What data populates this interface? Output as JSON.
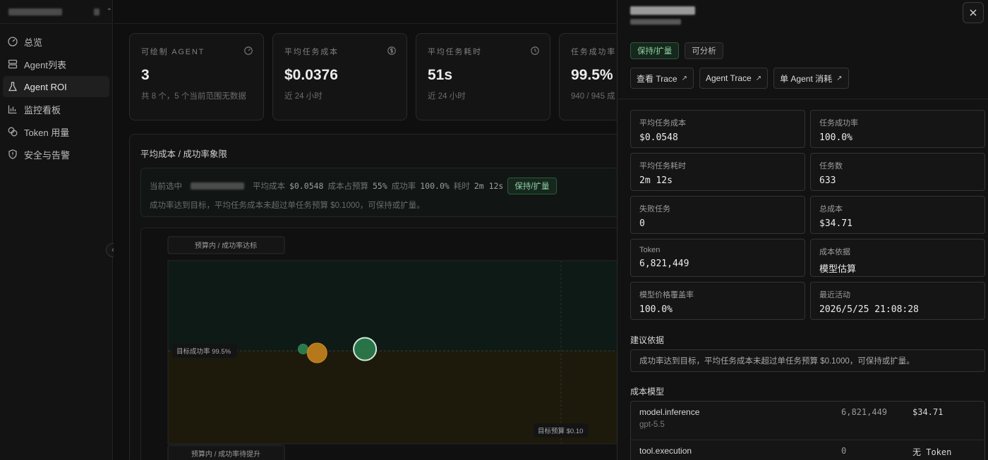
{
  "sidebar": {
    "workspace_switch_icon": "chevron-updown-icon",
    "collapse_icon": "chevron-left-icon",
    "items": [
      {
        "label": "总览",
        "icon": "gauge-icon",
        "active": false
      },
      {
        "label": "Agent列表",
        "icon": "server-icon",
        "active": false
      },
      {
        "label": "Agent ROI",
        "icon": "flask-icon",
        "active": true
      },
      {
        "label": "监控看板",
        "icon": "bar-chart-icon",
        "active": false
      },
      {
        "label": "Token 用量",
        "icon": "coins-icon",
        "active": false
      },
      {
        "label": "安全与告警",
        "icon": "shield-alert-icon",
        "active": false
      }
    ]
  },
  "kpis": [
    {
      "label": "可绘制 AGENT",
      "value": "3",
      "sub": "共 8 个，5 个当前范围无数据",
      "icon": "gauge-icon"
    },
    {
      "label": "平均任务成本",
      "value": "$0.0376",
      "sub": "近 24 小时",
      "icon": "dollar-circle-icon"
    },
    {
      "label": "平均任务耗时",
      "value": "51s",
      "sub": "近 24 小时",
      "icon": "clock-icon"
    },
    {
      "label": "任务成功率",
      "value": "99.5%",
      "sub": "940 / 945 成",
      "icon": ""
    }
  ],
  "quadrant_panel": {
    "title": "平均成本 / 成功率象限",
    "selected": {
      "prefix": "当前选中",
      "cost_label": "平均成本",
      "cost_value": "$0.0548",
      "budget_label": "成本占预算",
      "budget_value": "55%",
      "success_label": "成功率",
      "success_value": "100.0%",
      "duration_label": "耗时",
      "duration_value": "2m 12s",
      "tag": "保持/扩量",
      "description": "成功率达到目标，平均任务成本未超过单任务预算 $0.1000，可保持或扩量。"
    },
    "chart": {
      "quadrant_top_label": "预算内 / 成功率达标",
      "quadrant_bottom_label": "预算内 / 成功率待提升",
      "target_success_label": "目标成功率 99.5%",
      "target_budget_label": "目标预算 $0.10",
      "colors": {
        "success_zone": "#0e1a16",
        "warn_zone": "#1d1a0c",
        "dot_green": "#2f8a55",
        "dot_orange": "#d08a1d"
      }
    }
  },
  "chart_data": {
    "type": "scatter",
    "title": "平均成本 / 成功率象限",
    "xlabel": "",
    "ylabel": "",
    "reference_lines": {
      "target_success_rate": 99.5,
      "target_budget": 0.1
    },
    "series": [
      {
        "points": [
          {
            "x": 0.0376,
            "y": 100.0,
            "color": "#2f8a55",
            "size": "small"
          },
          {
            "x": 0.0415,
            "y": 98.9,
            "color": "#d08a1d",
            "size": "medium"
          },
          {
            "x": 0.0548,
            "y": 100.0,
            "color": "#2f8a55",
            "size": "large",
            "selected": true
          }
        ]
      }
    ]
  },
  "detail": {
    "close_icon": "close-icon",
    "tags": [
      "保持/扩量",
      "可分析"
    ],
    "links": [
      {
        "label": "查看 Trace",
        "icon": "arrow-up-right-icon"
      },
      {
        "label": "Agent Trace",
        "icon": "arrow-up-right-icon"
      },
      {
        "label": "单 Agent 消耗",
        "icon": "arrow-up-right-icon"
      }
    ],
    "metrics": [
      {
        "label": "平均任务成本",
        "value": "$0.0548"
      },
      {
        "label": "任务成功率",
        "value": "100.0%"
      },
      {
        "label": "平均任务耗时",
        "value": "2m 12s"
      },
      {
        "label": "任务数",
        "value": "633"
      },
      {
        "label": "失败任务",
        "value": "0"
      },
      {
        "label": "总成本",
        "value": "$34.71"
      },
      {
        "label": "Token",
        "value": "6,821,449"
      },
      {
        "label": "成本依据",
        "value": "模型估算"
      },
      {
        "label": "模型价格覆盖率",
        "value": "100.0%"
      },
      {
        "label": "最近活动",
        "value": "2026/5/25 21:08:28"
      }
    ],
    "reason_title": "建议依据",
    "reason_text": "成功率达到目标，平均任务成本未超过单任务预算 $0.1000，可保持或扩量。",
    "cost_model_title": "成本模型",
    "cost_model": [
      {
        "name": "model.inference",
        "model": "gpt-5.5",
        "tokens": "6,821,449",
        "cost": "$34.71"
      },
      {
        "name": "tool.execution",
        "model": "",
        "tokens": "0",
        "cost": "无 Token"
      }
    ]
  }
}
